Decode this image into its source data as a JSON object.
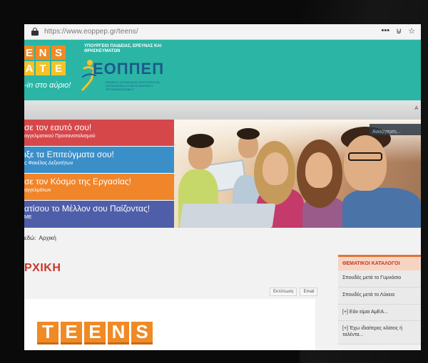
{
  "browser": {
    "url_host": "https://www.eoppep.gr",
    "url_path": "/teens/",
    "icons": [
      "more-icon",
      "pocket-icon",
      "bookmark-star-icon"
    ],
    "more_glyph": "•••",
    "pocket_glyph": "⊍",
    "star_glyph": "☆"
  },
  "header": {
    "teens_logo_row1": [
      "E",
      "N",
      "S"
    ],
    "teens_logo_row2": [
      "A",
      "T",
      "E"
    ],
    "slogan": "-in στο αύριο!",
    "ministry": "ΥΠΟΥΡΓΕΙΟ ΠΑΙΔΕΙΑΣ, ΕΡΕΥΝΑΣ ΚΑΙ ΘΡΗΣΚΕΥΜΑΤΩΝ",
    "eoppep_name": "ΕΟΠΠΕΠ",
    "eoppep_subtitle": "Εθνικός Οργανισμός Πιστοποίησης Προσόντων & Επαγγελματικού Προσανατολισμού"
  },
  "nav": {
    "letter": "Α"
  },
  "hero": {
    "banners": [
      {
        "title": "σε τον εαυτό σου!",
        "subtitle": "αγγελματικού Προσανατολισμού"
      },
      {
        "title": "ιξε τα Επιτεύγματα σου!",
        "subtitle": "ς Φακέλος Δεξιοτήτων"
      },
      {
        "title": "σε τον Κόσμο της Εργασίας!",
        "subtitle": "αγγελμάτων"
      },
      {
        "title": "ατίσου το Μέλλον σου Παίζοντας!",
        "subtitle": "ME"
      }
    ],
    "search_placeholder": "Αναζήτηση..."
  },
  "content": {
    "breadcrumb_label": "εδώ:",
    "breadcrumb_current": "Αρχική",
    "page_title": "ΡΧΙΚΗ",
    "print_label": "Εκτύπωση",
    "email_label": "Email",
    "article_logo": [
      "T",
      "E",
      "E",
      "N",
      "S"
    ]
  },
  "sidebar": {
    "title": "ΘΕΜΑΤΙΚΟΙ ΚΑΤΑΛΟΓΟΙ",
    "items": [
      "Σπουδές μετά το Γυμνάσιο",
      "Σπουδές μετά το Λύκειο",
      "[+] Εάν είμαι ΑμΕΑ...",
      "[+] Έχω ιδιαίτερες κλίσεις ή ταλέντα..."
    ]
  },
  "colors": {
    "header_teal": "#2bb5a5",
    "banner_red": "#d6474a",
    "banner_blue": "#3b8fc8",
    "banner_orange": "#f0852a",
    "banner_indigo": "#4e5ea9",
    "title_red": "#c9362a"
  }
}
